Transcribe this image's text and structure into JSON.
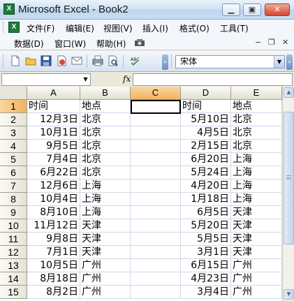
{
  "window": {
    "title": "Microsoft Excel - Book2",
    "minimize": "▁",
    "restore": "▣",
    "close": "✕"
  },
  "menu": {
    "row1": [
      "文件(F)",
      "编辑(E)",
      "视图(V)",
      "插入(I)",
      "格式(O)",
      "工具(T)"
    ],
    "row2": [
      "数据(D)",
      "窗口(W)",
      "帮助(H)"
    ]
  },
  "toolbar": {
    "font_name": "宋体"
  },
  "formula": {
    "name_box": "",
    "fx": "fx",
    "content": ""
  },
  "columns": [
    "A",
    "B",
    "C",
    "D",
    "E"
  ],
  "selected_column": "C",
  "selected_row": "1",
  "rows": [
    {
      "n": "1",
      "A": "时间",
      "B": "地点",
      "C": "",
      "D": "时间",
      "E": "地点"
    },
    {
      "n": "2",
      "A": "12月3日",
      "B": "北京",
      "C": "",
      "D": "5月10日",
      "E": "北京"
    },
    {
      "n": "3",
      "A": "10月1日",
      "B": "北京",
      "C": "",
      "D": "4月5日",
      "E": "北京"
    },
    {
      "n": "4",
      "A": "9月5日",
      "B": "北京",
      "C": "",
      "D": "2月15日",
      "E": "北京"
    },
    {
      "n": "5",
      "A": "7月4日",
      "B": "北京",
      "C": "",
      "D": "6月20日",
      "E": "上海"
    },
    {
      "n": "6",
      "A": "6月22日",
      "B": "北京",
      "C": "",
      "D": "5月24日",
      "E": "上海"
    },
    {
      "n": "7",
      "A": "12月6日",
      "B": "上海",
      "C": "",
      "D": "4月20日",
      "E": "上海"
    },
    {
      "n": "8",
      "A": "10月4日",
      "B": "上海",
      "C": "",
      "D": "1月18日",
      "E": "上海"
    },
    {
      "n": "9",
      "A": "8月10日",
      "B": "上海",
      "C": "",
      "D": "6月5日",
      "E": "天津"
    },
    {
      "n": "10",
      "A": "11月12日",
      "B": "天津",
      "C": "",
      "D": "5月20日",
      "E": "天津"
    },
    {
      "n": "11",
      "A": "9月8日",
      "B": "天津",
      "C": "",
      "D": "5月5日",
      "E": "天津"
    },
    {
      "n": "12",
      "A": "7月1日",
      "B": "天津",
      "C": "",
      "D": "3月1日",
      "E": "天津"
    },
    {
      "n": "13",
      "A": "10月5日",
      "B": "广州",
      "C": "",
      "D": "6月15日",
      "E": "广州"
    },
    {
      "n": "14",
      "A": "8月18日",
      "B": "广州",
      "C": "",
      "D": "4月23日",
      "E": "广州"
    },
    {
      "n": "15",
      "A": "8月2日",
      "B": "广州",
      "C": "",
      "D": "3月4日",
      "E": "广州"
    }
  ],
  "colors": {
    "selected_header": "#f1b35f",
    "gridline": "#d0d7e5"
  }
}
